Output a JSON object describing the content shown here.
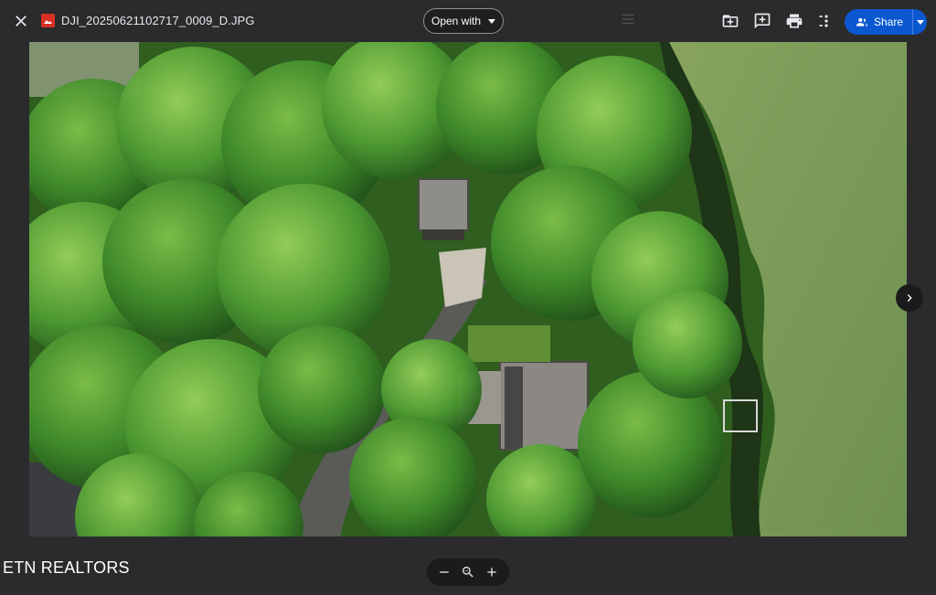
{
  "header": {
    "file_name": "DJI_20250621102717_0009_D.JPG",
    "open_with_label": "Open with",
    "share_label": "Share"
  },
  "icons": {
    "close": "close-icon",
    "file_type": "image-file-icon",
    "add_to_drive": "add-to-drive-icon",
    "add_comment": "add-comment-icon",
    "print": "print-icon",
    "more": "more-vert-icon",
    "share": "people-icon",
    "next": "chevron-right-icon",
    "zoom_out": "minus-icon",
    "zoom_reset": "magnifier-icon",
    "zoom_in": "plus-icon"
  },
  "image": {
    "description": "Aerial drone photo of a wooded lakeside property with two small buildings and a gravel driveway"
  },
  "watermark": {
    "text": "ETN REALTORS"
  },
  "colors": {
    "background": "#2b2b2d",
    "share_accent": "#0b57d0",
    "control_bg": "#1b1b1b"
  }
}
